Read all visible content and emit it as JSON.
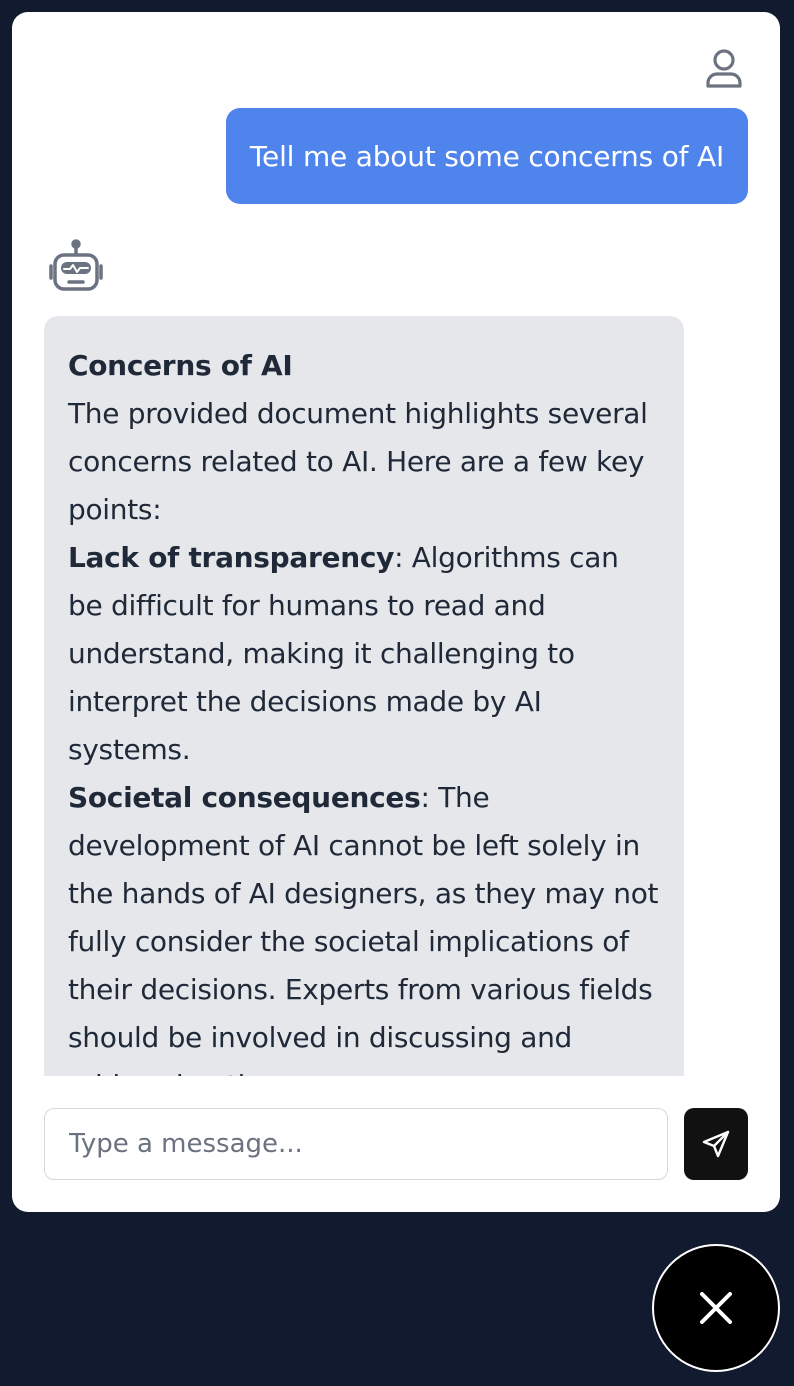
{
  "chat": {
    "user_message": "Tell me about some concerns of AI",
    "bot_message": {
      "title": "Concerns of AI",
      "intro": "The provided document highlights several concerns related to AI. Here are a few key points:",
      "points": [
        {
          "heading": "Lack of transparency",
          "text": ": Algorithms can be difficult for humans to read and understand, making it challenging to interpret the decisions made by AI systems."
        },
        {
          "heading": "Societal consequences",
          "text": ": The development of AI cannot be left solely in the hands of AI designers, as they may not fully consider the societal implications of their decisions. Experts from various fields should be involved in discussing and addressing these"
        }
      ]
    }
  },
  "composer": {
    "placeholder": "Type a message..."
  },
  "icons": {
    "user_avatar": "user-icon",
    "bot_avatar": "robot-icon",
    "send": "paper-plane-icon",
    "close": "close-icon"
  },
  "colors": {
    "background": "#111a2e",
    "user_bubble": "#4f84ec",
    "bot_bubble": "#e5e7eb",
    "send_button": "#111111"
  }
}
